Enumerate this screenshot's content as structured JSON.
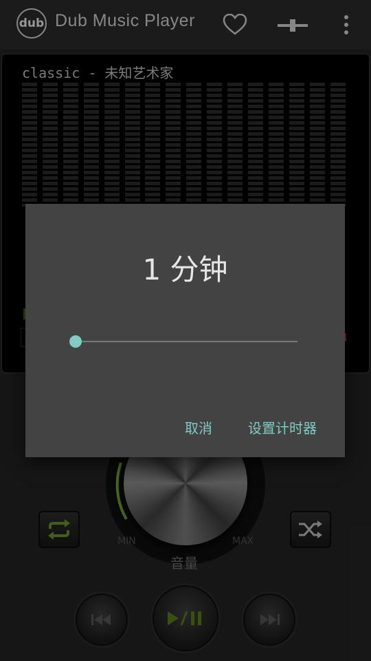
{
  "header": {
    "logo_text": "dub",
    "title": "Dub Music Player",
    "icons": [
      "heart-icon",
      "equalizer-toggle-icon",
      "more-vert-icon"
    ]
  },
  "visualizer": {
    "track_line": "classic - 未知艺术家",
    "bar_count": 16,
    "time_fragment": "0"
  },
  "controls": {
    "min_label": "MIN",
    "max_label": "MAX",
    "volume_label": "音量",
    "accent_color": "#8bc34a",
    "icons": [
      "repeat-icon",
      "shuffle-icon",
      "previous-icon",
      "play-pause-icon",
      "next-icon"
    ]
  },
  "dialog": {
    "timer_value": "1 分钟",
    "slider_value_fraction": 0,
    "cancel_label": "取消",
    "set_label": "设置计时器",
    "accent_color": "#80cbc4"
  }
}
